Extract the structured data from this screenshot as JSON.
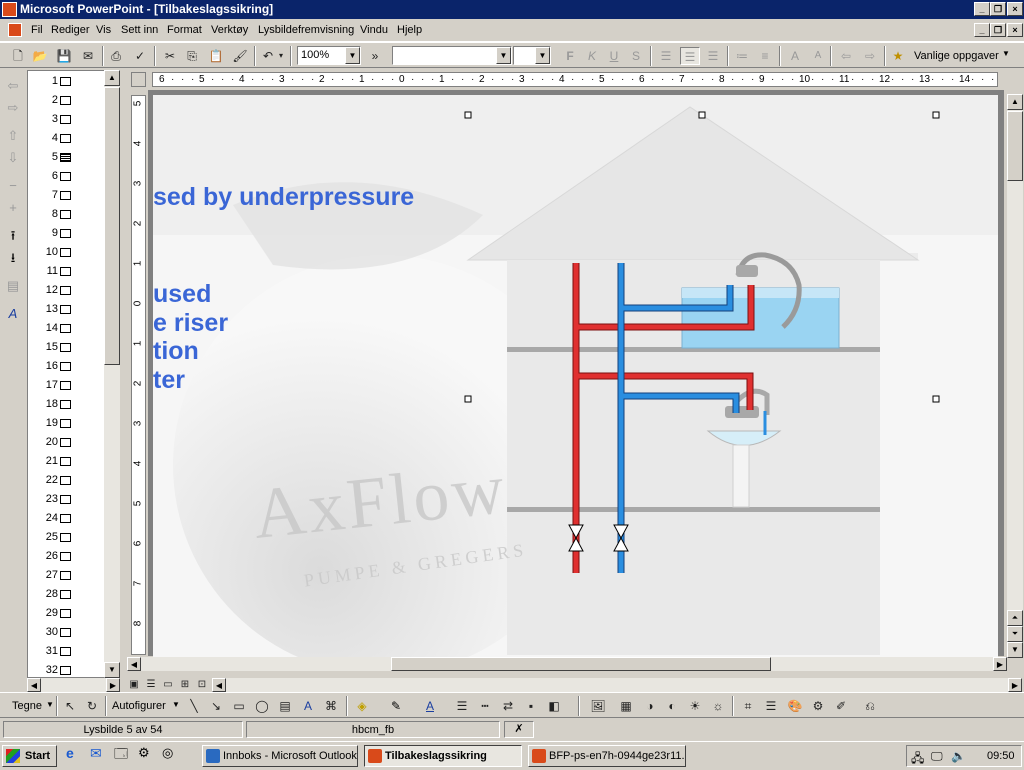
{
  "window": {
    "title": "Microsoft PowerPoint - [Tilbakeslagssikring]"
  },
  "menu": [
    "Fil",
    "Rediger",
    "Vis",
    "Sett inn",
    "Format",
    "Verktøy",
    "Lysbildefremvisning",
    "Vindu",
    "Hjelp"
  ],
  "toolbar": {
    "zoom": "100%",
    "font_name": "",
    "font_size": "",
    "common_tasks": "Vanlige oppgaver"
  },
  "ruler": {
    "h_labels": [
      "6",
      "5",
      "4",
      "3",
      "2",
      "1",
      "0",
      "1",
      "2",
      "3",
      "4",
      "5",
      "6",
      "7",
      "8",
      "9",
      "10",
      "11",
      "12",
      "13",
      "14"
    ],
    "v_labels": [
      "5",
      "4",
      "3",
      "2",
      "1",
      "0",
      "1",
      "2",
      "3",
      "4",
      "5",
      "6",
      "7",
      "8"
    ]
  },
  "outline": {
    "slides": [
      "1",
      "2",
      "3",
      "4",
      "5",
      "6",
      "7",
      "8",
      "9",
      "10",
      "11",
      "12",
      "13",
      "14",
      "15",
      "16",
      "17",
      "18",
      "19",
      "20",
      "21",
      "22",
      "23",
      "24",
      "25",
      "26",
      "27",
      "28",
      "29",
      "30",
      "31",
      "32"
    ]
  },
  "slide": {
    "heading": "sed by underpressure",
    "lines": [
      "used",
      "e riser",
      "tion",
      "ter"
    ],
    "watermark": "AxFlow",
    "watermark_sub": "PUMPE & GREGERS"
  },
  "drawing_toolbar": {
    "draw": "Tegne",
    "autoshapes": "Autofigurer"
  },
  "status": {
    "slide": "Lysbilde 5 av 54",
    "template": "hbcm_fb"
  },
  "taskbar": {
    "start": "Start",
    "buttons": [
      "Innboks - Microsoft Outlook",
      "Tilbakeslagssikring",
      "BFP-ps-en7h-0944ge23r11..."
    ],
    "clock": "09:50"
  },
  "colors": {
    "hot": "#e03030",
    "cold": "#2a8ee0",
    "slide_text": "#3a66d6",
    "title_bar": "#0a246a"
  }
}
